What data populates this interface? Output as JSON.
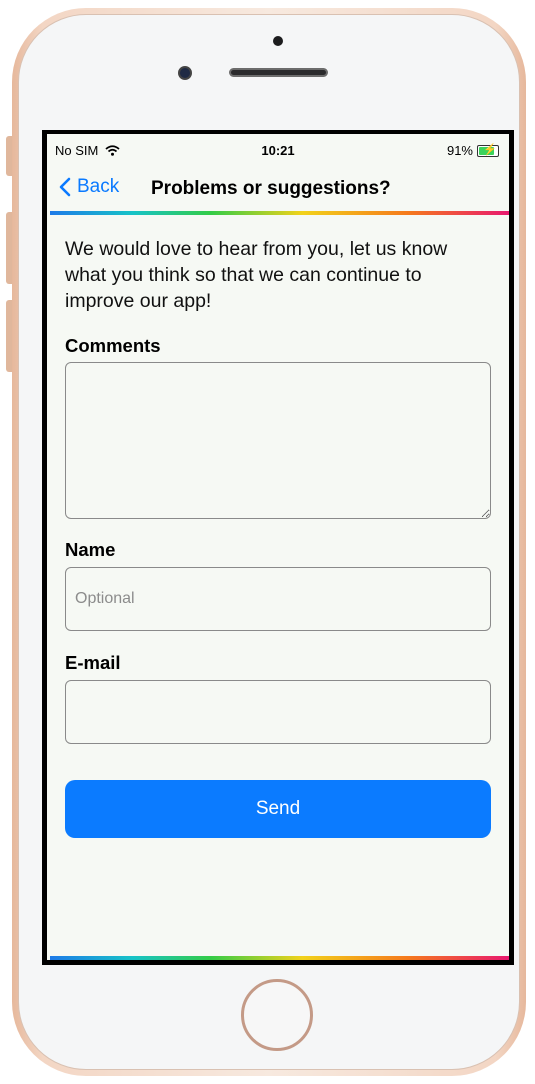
{
  "status_bar": {
    "carrier": "No SIM",
    "time": "10:21",
    "battery_percent": "91%",
    "battery_level": 0.91,
    "wifi_icon": "wifi-icon",
    "battery_icon": "battery-charging-icon"
  },
  "nav": {
    "back_label": "Back",
    "back_icon": "chevron-left-icon",
    "title": "Problems or suggestions?"
  },
  "form": {
    "intro": "We would love to hear from you, let us know what you think so that we can continue to improve our app!",
    "comments_label": "Comments",
    "comments_value": "",
    "name_label": "Name",
    "name_placeholder": "Optional",
    "name_value": "",
    "email_label": "E-mail",
    "email_value": "",
    "send_label": "Send"
  },
  "colors": {
    "accent": "#0b7bff",
    "background": "#f6f9f4"
  }
}
